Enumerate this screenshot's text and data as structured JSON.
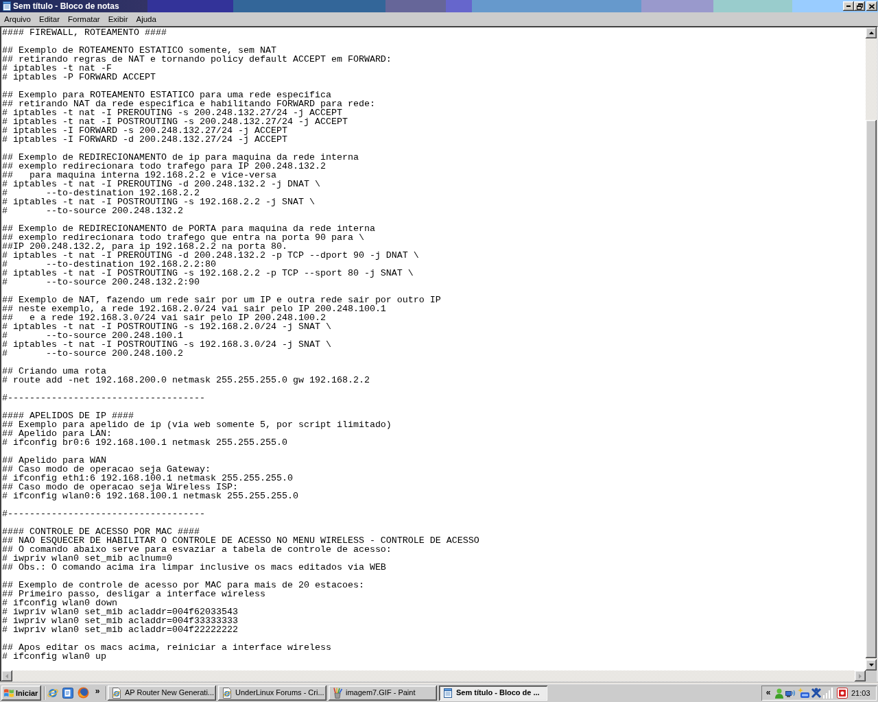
{
  "window": {
    "title": "Sem título - Bloco de notas"
  },
  "menu_bar": [
    "Arquivo",
    "Editar",
    "Formatar",
    "Exibir",
    "Ajuda"
  ],
  "editor": {
    "blocks": [
      [
        "#### FIREWALL, ROTEAMENTO ####"
      ],
      [
        "## Exemplo de ROTEAMENTO ESTATICO somente, sem NAT",
        "## retirando regras de NAT e tornando policy default ACCEPT em FORWARD:",
        "# iptables -t nat -F",
        "# iptables -P FORWARD ACCEPT"
      ],
      [
        "## Exemplo para ROTEAMENTO ESTATICO para uma rede especifica",
        "## retirando NAT da rede especifica e habilitando FORWARD para rede:",
        "# iptables -t nat -I PREROUTING -s 200.248.132.27/24 -j ACCEPT",
        "# iptables -t nat -I POSTROUTING -s 200.248.132.27/24 -j ACCEPT",
        "# iptables -I FORWARD -s 200.248.132.27/24 -j ACCEPT",
        "# iptables -I FORWARD -d 200.248.132.27/24 -j ACCEPT"
      ],
      [
        "## Exemplo de REDIRECIONAMENTO de ip para maquina da rede interna",
        "## exemplo redirecionara todo trafego para IP 200.248.132.2",
        "##   para maquina interna 192.168.2.2 e vice-versa",
        "# iptables -t nat -I PREROUTING -d 200.248.132.2 -j DNAT \\",
        "#       --to-destination 192.168.2.2",
        "# iptables -t nat -I POSTROUTING -s 192.168.2.2 -j SNAT \\",
        "#       --to-source 200.248.132.2"
      ],
      [
        "## Exemplo de REDIRECIONAMENTO de PORTA para maquina da rede interna",
        "## exemplo redirecionara todo trafego que entra na porta 90 para \\",
        "##IP 200.248.132.2, para ip 192.168.2.2 na porta 80.",
        "# iptables -t nat -I PREROUTING -d 200.248.132.2 -p TCP --dport 90 -j DNAT \\",
        "#       --to-destination 192.168.2.2:80",
        "# iptables -t nat -I POSTROUTING -s 192.168.2.2 -p TCP --sport 80 -j SNAT \\",
        "#       --to-source 200.248.132.2:90"
      ],
      [
        "## Exemplo de NAT, fazendo um rede sair por um IP e outra rede sair por outro IP",
        "## neste exemplo, a rede 192.168.2.0/24 vai sair pelo IP 200.248.100.1",
        "##   e a rede 192.168.3.0/24 vai sair pelo IP 200.248.100.2",
        "# iptables -t nat -I POSTROUTING -s 192.168.2.0/24 -j SNAT \\",
        "#       --to-source 200.248.100.1",
        "# iptables -t nat -I POSTROUTING -s 192.168.3.0/24 -j SNAT \\",
        "#       --to-source 200.248.100.2"
      ],
      [
        "## Criando uma rota",
        "# route add -net 192.168.200.0 netmask 255.255.255.0 gw 192.168.2.2"
      ],
      [
        "#------------------------------------"
      ],
      [
        "#### APELIDOS DE IP ####",
        "## Exemplo para apelido de ip (via web somente 5, por script ilimitado)",
        "## Apelido para LAN:",
        "# ifconfig br0:6 192.168.100.1 netmask 255.255.255.0"
      ],
      [
        "## Apelido para WAN",
        "## Caso modo de operacao seja Gateway:",
        "# ifconfig eth1:6 192.168.100.1 netmask 255.255.255.0",
        "## Caso modo de operacao seja Wireless ISP:",
        "# ifconfig wlan0:6 192.168.100.1 netmask 255.255.255.0"
      ],
      [
        "#------------------------------------"
      ],
      [
        "#### CONTROLE DE ACESSO POR MAC ####",
        "## NAO ESQUECER DE HABILITAR O CONTROLE DE ACESSO NO MENU WIRELESS - CONTROLE DE ACESSO",
        "## O comando abaixo serve para esvaziar a tabela de controle de acesso:",
        "# iwpriv wlan0 set_mib aclnum=0",
        "## Obs.: O comando acima ira limpar inclusive os macs editados via WEB"
      ],
      [
        "## Exemplo de controle de acesso por MAC para mais de 20 estacoes:",
        "## Primeiro passo, desligar a interface wireless",
        "# ifconfig wlan0 down",
        "# iwpriv wlan0 set_mib acladdr=004f62033543",
        "# iwpriv wlan0 set_mib acladdr=004f33333333",
        "# iwpriv wlan0 set_mib acladdr=004f22222222"
      ],
      [
        "## Apos editar os macs acima, reiniciar a interface wireless",
        "# ifconfig wlan0 up"
      ]
    ]
  },
  "taskbar": {
    "start_button": "Iniciar",
    "quick_launch_more": "»",
    "tasks": [
      {
        "label": "AP Router New Generati...",
        "kind": "browser",
        "selected": false
      },
      {
        "label": "UnderLinux Forums - Cri...",
        "kind": "browser",
        "selected": false
      },
      {
        "label": "imagem7.GIF - Paint",
        "kind": "paint",
        "selected": false
      },
      {
        "label": "Sem título - Bloco de ...",
        "kind": "notepad",
        "selected": true
      }
    ],
    "tray_expand": "«",
    "clock": "21:03"
  }
}
